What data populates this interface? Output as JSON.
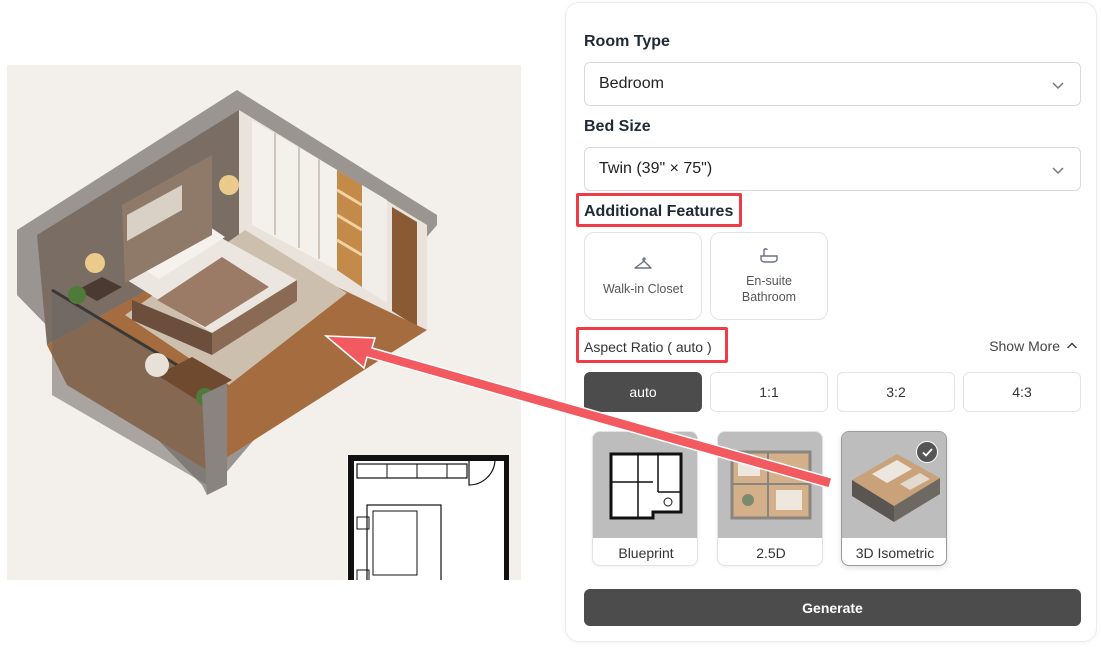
{
  "room_type": {
    "label": "Room Type",
    "value": "Bedroom"
  },
  "bed_size": {
    "label": "Bed Size",
    "value": "Twin (39\" × 75\")"
  },
  "additional_features": {
    "label": "Additional Features",
    "items": [
      {
        "icon": "hanger-icon",
        "label": "Walk-in Closet"
      },
      {
        "icon": "bathtub-icon",
        "label": "En-suite\nBathroom"
      }
    ]
  },
  "aspect_ratio": {
    "label": "Aspect Ratio ( auto )",
    "show_more": "Show More",
    "options": [
      "auto",
      "1:1",
      "3:2",
      "4:3"
    ],
    "selected": "auto"
  },
  "styles": {
    "items": [
      "Blueprint",
      "2.5D",
      "3D Isometric"
    ],
    "selected": "3D Isometric"
  },
  "generate_label": "Generate",
  "colors": {
    "highlight": "#ef3b46",
    "button_dark": "#4c4c4c",
    "arrow": "#f25a60"
  }
}
